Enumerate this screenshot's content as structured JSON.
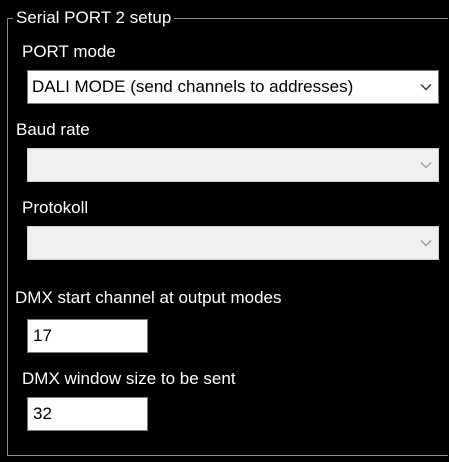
{
  "group": {
    "title": "Serial PORT 2 setup"
  },
  "port_mode": {
    "label": "PORT mode",
    "selected": "DALI MODE (send channels to addresses)"
  },
  "baud_rate": {
    "label": "Baud rate",
    "selected": ""
  },
  "protokoll": {
    "label": "Protokoll",
    "selected": ""
  },
  "dmx_start": {
    "label": "DMX start channel at output modes",
    "value": "17"
  },
  "dmx_window": {
    "label": "DMX window size to be sent",
    "value": "32"
  },
  "icons": {
    "dropdown": "chevron-down-icon"
  },
  "colors": {
    "background": "#000000",
    "text": "#ffffff",
    "disabled_field": "#f0f0f0",
    "active_chevron": "#333333",
    "disabled_chevron": "#a0a0a0"
  }
}
